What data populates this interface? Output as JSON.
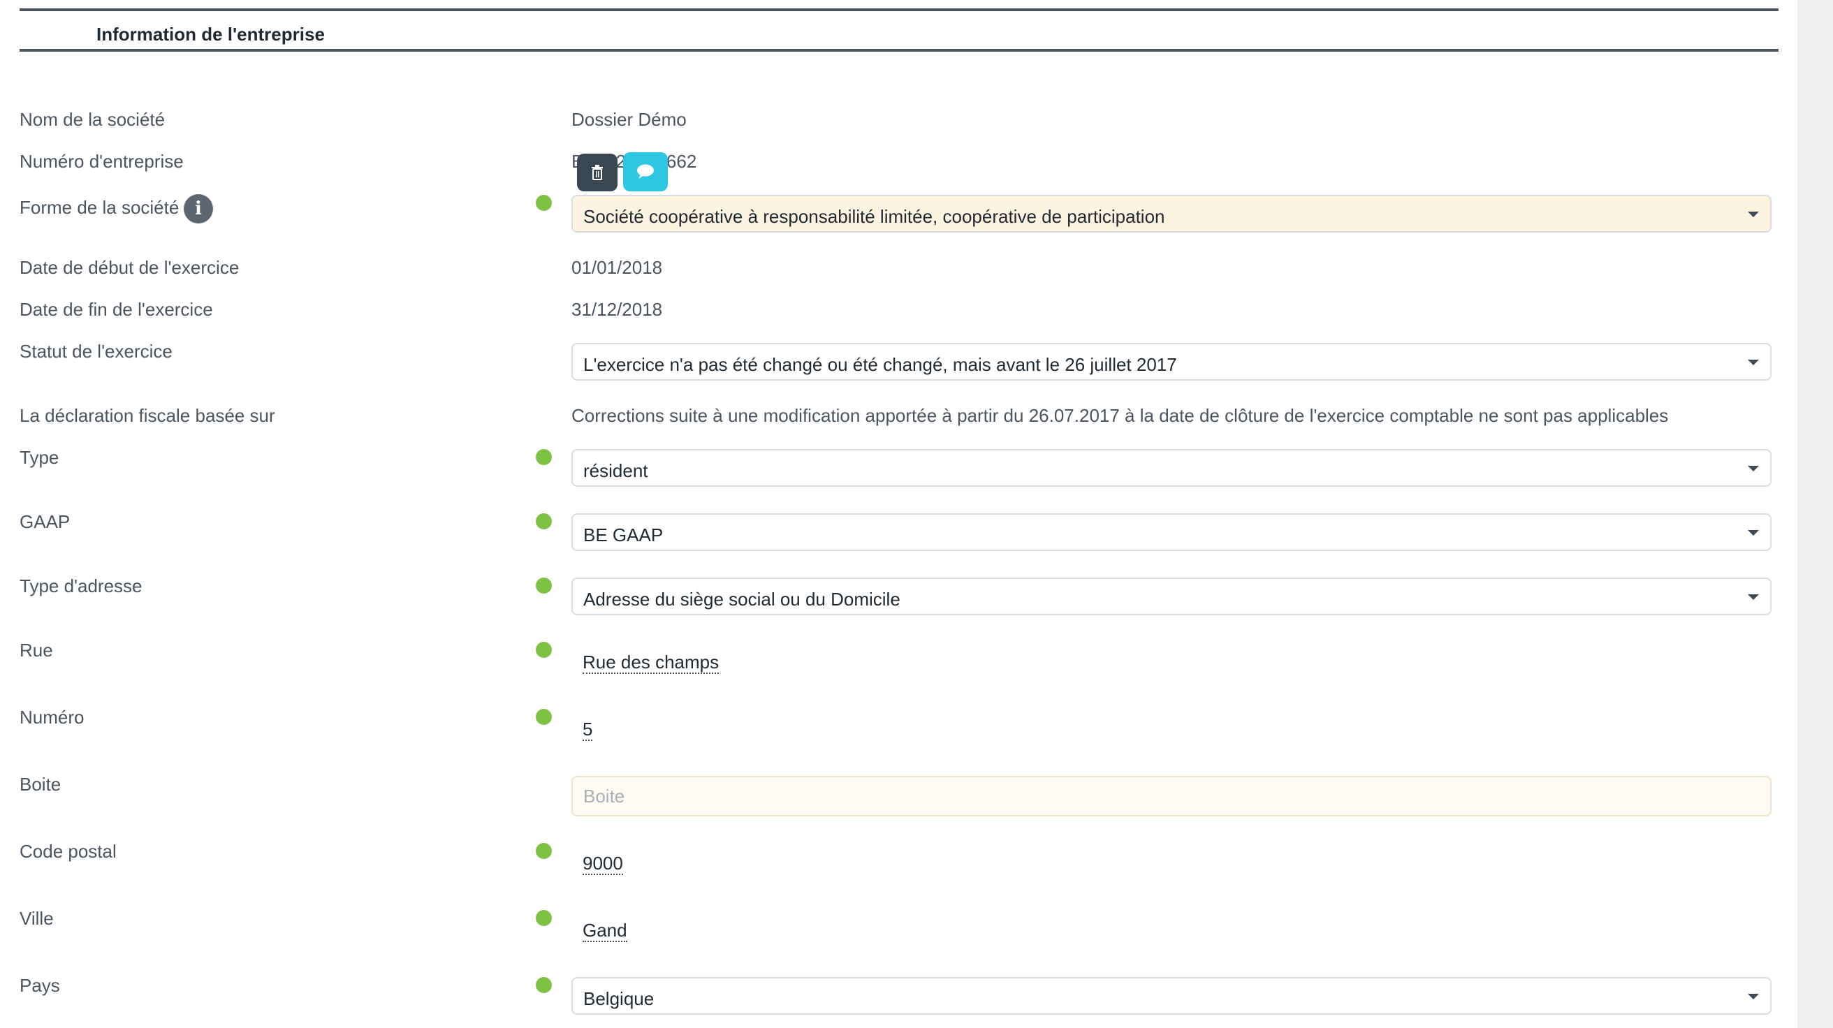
{
  "header": {
    "title": "Information de l'entreprise"
  },
  "fields": {
    "company_name": {
      "label": "Nom de la société",
      "value": "Dossier Démo"
    },
    "company_number": {
      "label": "Numéro d'entreprise",
      "value": "BE0524803662"
    },
    "company_form": {
      "label": "Forme de la société",
      "value": "Société coopérative à responsabilité limitée, coopérative de participation"
    },
    "fiscal_start": {
      "label": "Date de début de l'exercice",
      "value": "01/01/2018"
    },
    "fiscal_end": {
      "label": "Date de fin de l'exercice",
      "value": "31/12/2018"
    },
    "fiscal_status": {
      "label": "Statut de l'exercice",
      "value": "L'exercice n'a pas été changé ou été changé, mais avant le 26 juillet 2017"
    },
    "tax_declaration": {
      "label": "La déclaration fiscale basée sur",
      "value": "Corrections suite à une modification apportée à partir du 26.07.2017 à la date de clôture de l'exercice comptable ne sont pas applicables"
    },
    "type": {
      "label": "Type",
      "value": "résident"
    },
    "gaap": {
      "label": "GAAP",
      "value": "BE GAAP"
    },
    "address_type": {
      "label": "Type d'adresse",
      "value": "Adresse du siège social ou du Domicile"
    },
    "street": {
      "label": "Rue",
      "value": "Rue des champs"
    },
    "number": {
      "label": "Numéro",
      "value": "5"
    },
    "box": {
      "label": "Boite",
      "placeholder": "Boite",
      "value": ""
    },
    "postal_code": {
      "label": "Code postal",
      "value": "9000"
    },
    "city": {
      "label": "Ville",
      "value": "Gand"
    },
    "country": {
      "label": "Pays",
      "value": "Belgique"
    }
  },
  "icons": {
    "info": "info-icon",
    "delete": "trash-icon",
    "comment": "comment-icon",
    "dropdown": "caret-down-icon"
  },
  "colors": {
    "status_dot": "#7dc243",
    "comment_button": "#2ec7e3",
    "delete_button": "#3a4650",
    "highlight_field": "#fdf3e1"
  }
}
